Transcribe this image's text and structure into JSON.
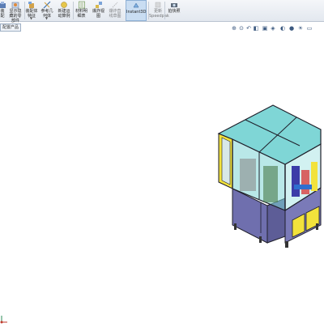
{
  "toolbar": {
    "buttons": [
      {
        "label": "装\n配"
      },
      {
        "label": "显示隐\n藏的零\n部件"
      },
      {
        "label": "装配体\n特征"
      },
      {
        "label": "参考几\n何体"
      },
      {
        "label": "新建运\n动算例"
      },
      {
        "label": "材料明\n细表"
      },
      {
        "label": "爆炸视\n图"
      },
      {
        "label": "爆炸直\n线草图"
      },
      {
        "label": "Instant3D"
      },
      {
        "label": "更新\nSpeedpak"
      },
      {
        "label": "拍快照"
      }
    ]
  },
  "tab": {
    "label": "配置产品"
  },
  "view_icons": [
    "zoom-fit-icon",
    "zoom-area-icon",
    "previous-view-icon",
    "section-view-icon",
    "view-orientation-icon",
    "display-style-icon",
    "hide-show-icon",
    "edit-appearance-icon",
    "scene-icon",
    "display-settings-icon"
  ],
  "colors": {
    "frame": "#1f1f2a",
    "glass": "#7fd6d6",
    "panel": "#6f6fae",
    "yellow": "#f2e23c"
  }
}
